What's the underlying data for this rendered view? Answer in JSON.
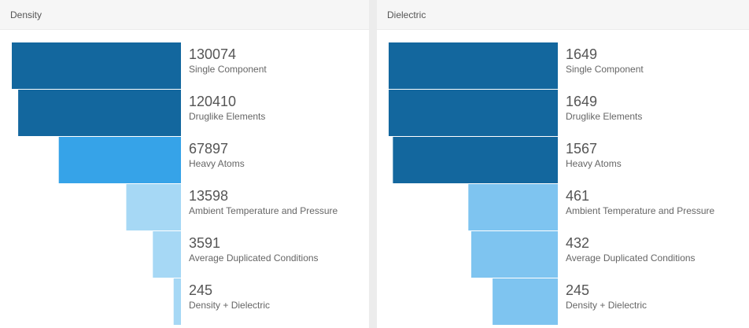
{
  "chart_data": [
    {
      "type": "bar",
      "title": "Density",
      "categories": [
        "Single Component",
        "Druglike Elements",
        "Heavy Atoms",
        "Ambient Temperature and Pressure",
        "Average Duplicated Conditions",
        "Density + Dielectric"
      ],
      "values": [
        130074,
        120410,
        67897,
        13598,
        3591,
        245
      ],
      "colors": [
        "#13679e",
        "#13679e",
        "#36a3e8",
        "#a6d8f5",
        "#a6d8f5",
        "#a6d8f5"
      ]
    },
    {
      "type": "bar",
      "title": "Dielectric",
      "categories": [
        "Single Component",
        "Druglike Elements",
        "Heavy Atoms",
        "Ambient Temperature and Pressure",
        "Average Duplicated Conditions",
        "Density + Dielectric"
      ],
      "values": [
        1649,
        1649,
        1567,
        461,
        432,
        245
      ],
      "colors": [
        "#13679e",
        "#13679e",
        "#13679e",
        "#7ec4f0",
        "#7ec4f0",
        "#7ec4f0"
      ]
    }
  ]
}
